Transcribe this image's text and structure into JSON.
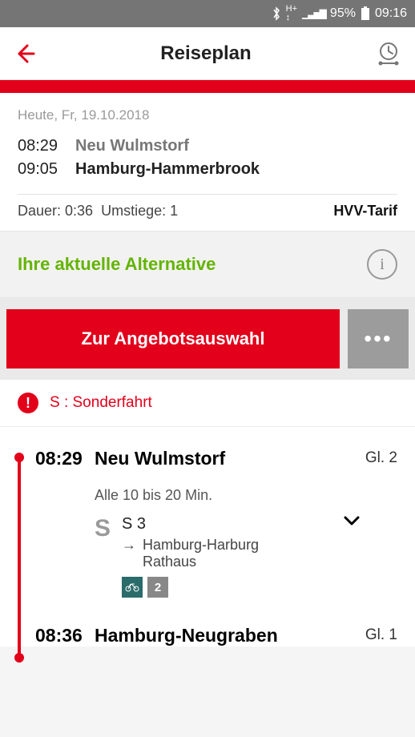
{
  "status": {
    "battery": "95%",
    "time": "09:16"
  },
  "header": {
    "title": "Reiseplan"
  },
  "summary": {
    "date": "Heute, Fr, 19.10.2018",
    "dep_time": "08:29",
    "origin": "Neu Wulmstorf",
    "arr_time": "09:05",
    "destination": "Hamburg-Hammerbrook",
    "duration_label": "Dauer: 0:36",
    "changes_label": "Umstiege: 1",
    "tariff": "HVV-Tarif"
  },
  "alternative": {
    "label": "Ihre aktuelle Alternative"
  },
  "cta": {
    "offers": "Zur Angebotsauswahl",
    "more": "•••"
  },
  "notice": {
    "text": "S : Sonderfahrt"
  },
  "legs": [
    {
      "time": "08:29",
      "station": "Neu Wulmstorf",
      "platform": "Gl. 2",
      "frequency": "Alle 10 bis 20 Min.",
      "mode_icon": "S",
      "line": "S 3",
      "direction": "Hamburg-Harburg Rathaus",
      "badges": {
        "bike": "⚲",
        "class": "2"
      }
    },
    {
      "time": "08:36",
      "station": "Hamburg-Neugraben",
      "platform": "Gl. 1"
    }
  ]
}
